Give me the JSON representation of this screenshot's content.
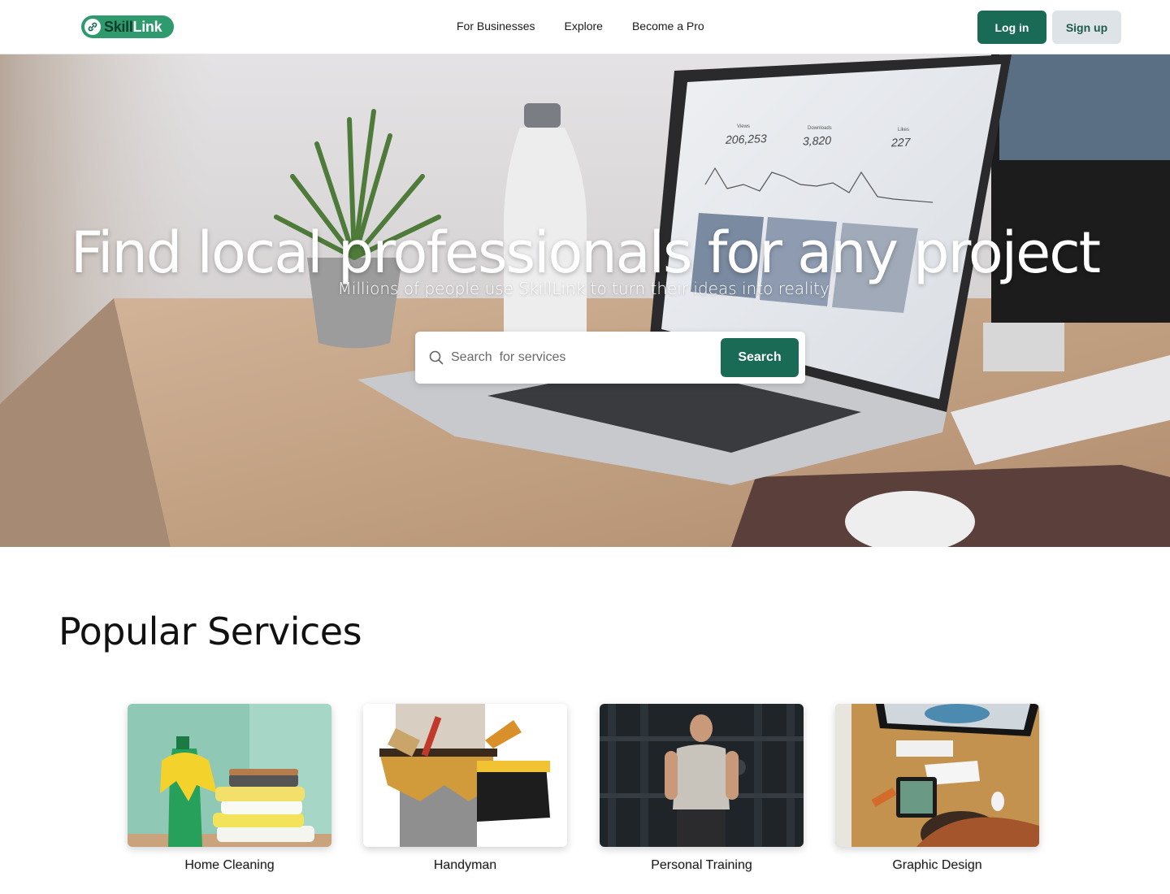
{
  "brand": {
    "name_part1": "Skill",
    "name_part2": "Link"
  },
  "nav": {
    "items": [
      "For Businesses",
      "Explore",
      "Become a Pro"
    ]
  },
  "auth": {
    "login_label": "Log in",
    "signup_label": "Sign up"
  },
  "hero": {
    "title": "Find local professionals for any project",
    "subtitle": "Millions of people use SkillLink to turn their ideas into reality.",
    "search_placeholder": "Search  for services",
    "search_button": "Search",
    "screen_stats": [
      {
        "label": "Views",
        "value": "206,253"
      },
      {
        "label": "Downloads",
        "value": "3,820"
      },
      {
        "label": "Likes",
        "value": "227"
      }
    ]
  },
  "popular": {
    "title": "Popular Services",
    "services": [
      {
        "label": "Home Cleaning"
      },
      {
        "label": "Handyman"
      },
      {
        "label": "Personal Training"
      },
      {
        "label": "Graphic Design"
      }
    ]
  },
  "colors": {
    "primary": "#196b56",
    "brand_green": "#2f9a6e",
    "signup_bg": "#dde3e6"
  }
}
